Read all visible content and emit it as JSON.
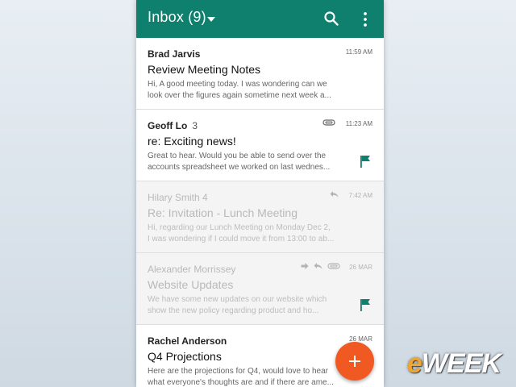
{
  "app": {
    "title": "Inbox (9)",
    "accent_color": "#0f7f6e",
    "fab_color": "#f05a22",
    "icons": {
      "search": "search-icon",
      "more": "more-vert-icon",
      "fab": "plus-icon"
    }
  },
  "emails": [
    {
      "sender": "Brad Jarvis",
      "count": "",
      "time": "11:59 AM",
      "subject": "Review Meeting Notes",
      "snippet": "Hi, A good meeting today. I was wondering can we look over the figures again sometime next week a...",
      "read": false,
      "flagged": false,
      "icons": []
    },
    {
      "sender": "Geoff Lo",
      "count": "3",
      "time": "11:23 AM",
      "subject": "re: Exciting news!",
      "snippet": "Great to hear. Would you be able to send over the accounts spreadsheet we worked on last wednes...",
      "read": false,
      "flagged": true,
      "icons": [
        "attachment-icon"
      ]
    },
    {
      "sender": "Hilary Smith 4",
      "count": "",
      "time": "7:42 AM",
      "subject": "Re: Invitation - Lunch Meeting",
      "snippet": "Hi, regarding our Lunch Meeting on Monday Dec 2, I was wondering if I could move it from 13:00 to ab...",
      "read": true,
      "flagged": false,
      "icons": [
        "reply-icon"
      ]
    },
    {
      "sender": "Alexander Morrissey",
      "count": "",
      "time": "26 MAR",
      "subject": "Website Updates",
      "snippet": "We have some new updates on our website which show the new policy regarding product and ho...",
      "read": true,
      "flagged": true,
      "icons": [
        "forward-icon",
        "reply-icon",
        "attachment-icon"
      ]
    },
    {
      "sender": "Rachel Anderson",
      "count": "",
      "time": "26 MAR",
      "subject": "Q4 Projections",
      "snippet": "Here are the projections for Q4, would love to hear what everyone's thoughts are and if there are ame...",
      "read": false,
      "flagged": false,
      "icons": []
    }
  ],
  "watermark": {
    "prefix": "e",
    "rest": "WEEK"
  }
}
